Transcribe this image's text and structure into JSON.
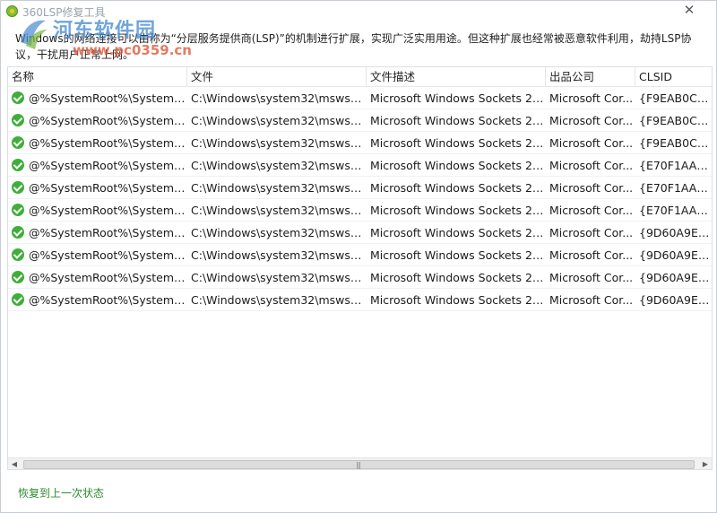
{
  "window": {
    "title": "360LSP修复工具",
    "close_glyph": "✕"
  },
  "watermark": {
    "name": "河东软件园",
    "url": "www.pc0359.cn"
  },
  "description": "Windows的网络连接可以由称为“分层服务提供商(LSP)”的机制进行扩展，实现广泛实用用途。但这种扩展也经常被恶意软件利用，劫持LSP协议，干扰用户正常上网。",
  "table": {
    "columns": [
      "名称",
      "文件",
      "文件描述",
      "出品公司",
      "CLSID"
    ],
    "rows": [
      {
        "name": "@%SystemRoot%\\System32...",
        "file": "C:\\Windows\\system32\\mswsock...",
        "desc": "Microsoft Windows Sockets 2.0...",
        "company": "Microsoft Cor...",
        "clsid": "{F9EAB0C0-2..."
      },
      {
        "name": "@%SystemRoot%\\System32...",
        "file": "C:\\Windows\\system32\\mswsock...",
        "desc": "Microsoft Windows Sockets 2.0...",
        "company": "Microsoft Cor...",
        "clsid": "{F9EAB0C0-2..."
      },
      {
        "name": "@%SystemRoot%\\System32...",
        "file": "C:\\Windows\\system32\\mswsock...",
        "desc": "Microsoft Windows Sockets 2.0...",
        "company": "Microsoft Cor...",
        "clsid": "{F9EAB0C0-2..."
      },
      {
        "name": "@%SystemRoot%\\System32...",
        "file": "C:\\Windows\\system32\\mswsock...",
        "desc": "Microsoft Windows Sockets 2.0...",
        "company": "Microsoft Cor...",
        "clsid": "{E70F1AA0-A..."
      },
      {
        "name": "@%SystemRoot%\\System32...",
        "file": "C:\\Windows\\system32\\mswsock...",
        "desc": "Microsoft Windows Sockets 2.0...",
        "company": "Microsoft Cor...",
        "clsid": "{E70F1AA0-A..."
      },
      {
        "name": "@%SystemRoot%\\System32...",
        "file": "C:\\Windows\\system32\\mswsock...",
        "desc": "Microsoft Windows Sockets 2.0...",
        "company": "Microsoft Cor...",
        "clsid": "{E70F1AA0-A..."
      },
      {
        "name": "@%SystemRoot%\\System32...",
        "file": "C:\\Windows\\system32\\mswsock...",
        "desc": "Microsoft Windows Sockets 2.0...",
        "company": "Microsoft Cor...",
        "clsid": "{9D60A9E0-3..."
      },
      {
        "name": "@%SystemRoot%\\System32...",
        "file": "C:\\Windows\\system32\\mswsock...",
        "desc": "Microsoft Windows Sockets 2.0...",
        "company": "Microsoft Cor...",
        "clsid": "{9D60A9E0-3..."
      },
      {
        "name": "@%SystemRoot%\\System32...",
        "file": "C:\\Windows\\system32\\mswsock...",
        "desc": "Microsoft Windows Sockets 2.0...",
        "company": "Microsoft Cor...",
        "clsid": "{9D60A9E0-3..."
      },
      {
        "name": "@%SystemRoot%\\System32...",
        "file": "C:\\Windows\\system32\\mswsock...",
        "desc": "Microsoft Windows Sockets 2.0...",
        "company": "Microsoft Cor...",
        "clsid": "{9D60A9E0-3..."
      }
    ]
  },
  "scrollbar": {
    "left_arrow": "◀",
    "right_arrow": "▶",
    "grip": "|||"
  },
  "footer": {
    "restore_label": "恢复到上一次状态"
  },
  "colors": {
    "status_ok": "#3fae3a",
    "link": "#2d8a2f"
  }
}
